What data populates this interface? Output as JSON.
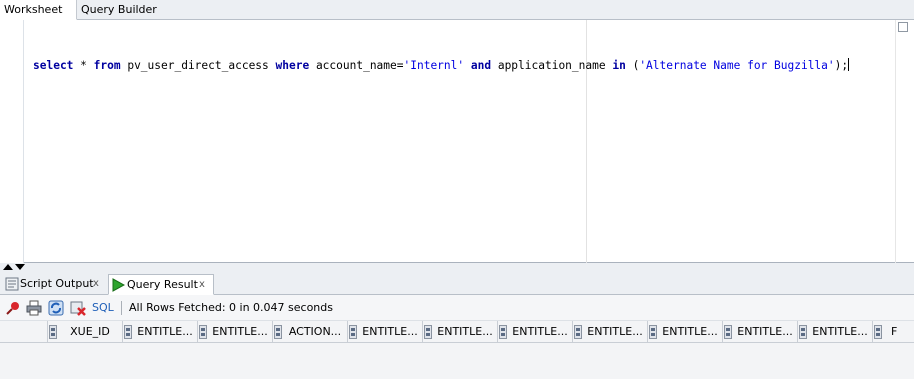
{
  "top_tabs": {
    "worksheet": "Worksheet",
    "query_builder": "Query Builder"
  },
  "editor": {
    "sql_parts": {
      "kw_select": "select",
      "star": " * ",
      "kw_from": "from",
      "table": " pv_user_direct_access ",
      "kw_where": "where",
      "cond1": " account_name=",
      "val1": "'Internl'",
      "sp1": " ",
      "kw_and": "and",
      "cond2": " application_name ",
      "kw_in": "in",
      "open": " (",
      "val2": "'Alternate Name for Bugzilla'",
      "close": ");"
    }
  },
  "bottom_tabs": {
    "script_output": "Script Output",
    "query_result": "Query Result",
    "close_glyph": "x"
  },
  "toolbar": {
    "sql_label": "SQL",
    "separator": "|",
    "status": "All Rows Fetched: 0 in 0.047 seconds",
    "icons": [
      "pin-icon",
      "print-icon",
      "refresh-icon",
      "delete-icon"
    ]
  },
  "grid": {
    "columns": [
      "XUE_ID",
      "ENTITLE...",
      "ENTITLE...",
      "ACTION...",
      "ENTITLE...",
      "ENTITLE...",
      "ENTITLE...",
      "ENTITLE...",
      "ENTITLE...",
      "ENTITLE...",
      "ENTITLE...",
      "F"
    ]
  },
  "colors": {
    "keyword": "#0000a0",
    "string": "#0000e0",
    "link": "#1f5fb8",
    "panel_bg": "#eceff3"
  }
}
